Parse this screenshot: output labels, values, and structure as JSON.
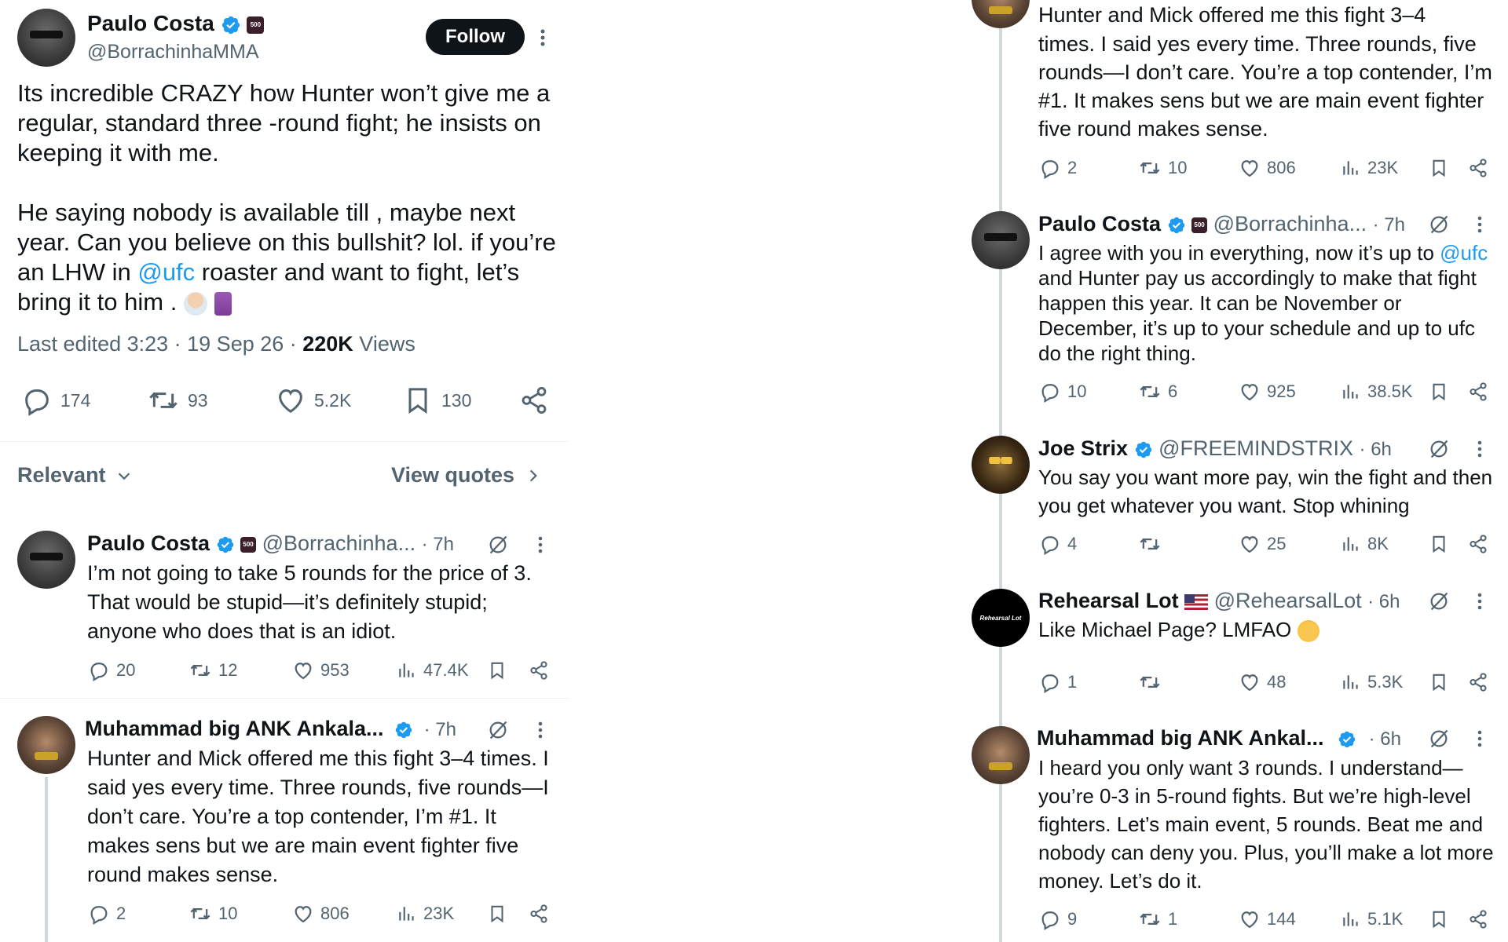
{
  "main_tweet": {
    "author_name": "Paulo Costa",
    "author_handle": "@BorrachinhaMMA",
    "affiliate_badge": "500",
    "follow_label": "Follow",
    "text_para1": "Its incredible CRAZY how Hunter won’t give me a regular, standard three -round fight; he insists on keeping it with me.",
    "text_para2_pre": "He saying nobody is available till , maybe next year. Can you believe on this bullshit? lol. if you’re an LHW in ",
    "text_link": "@ufc",
    "text_para2_post": " roaster and want to fight, let’s bring it to him .",
    "meta_prefix": "Last edited 3:23 · 19 Sep 26 · ",
    "views_count": "220K",
    "views_label": " Views",
    "stats": {
      "replies": "174",
      "reposts": "93",
      "likes": "5.2K",
      "bookmarks": "130"
    }
  },
  "sort_bar": {
    "sort_label": "Relevant",
    "quotes_label": "View quotes"
  },
  "left_replies": [
    {
      "name": "Paulo Costa",
      "handle": "@Borrachinha...",
      "time": "· 7h",
      "text": "I’m not going to take 5 rounds for the price of 3. That would be stupid—it’s definitely stupid; anyone who does that is an idiot.",
      "replies": "20",
      "reposts": "12",
      "likes": "953",
      "views": "47.4K"
    },
    {
      "name": "Muhammad big ANK Ankala...",
      "handle": "",
      "time": "· 7h",
      "text": "Hunter and Mick offered me this fight 3–4 times. I said yes every time. Three rounds, five rounds—I don’t care. You’re a top contender, I’m #1. It makes sens but we are main event fighter five round makes sense.",
      "replies": "2",
      "reposts": "10",
      "likes": "806",
      "views": "23K"
    }
  ],
  "right_top": {
    "text_partial_line": "Hunter and Mick offered me this fight 3–4",
    "text_rest": "times. I said yes every time. Three rounds, five rounds—I don’t care. You’re a top contender, I’m #1. It makes sens but we are main event fighter five round makes sense.",
    "replies": "2",
    "reposts": "10",
    "likes": "806",
    "views": "23K"
  },
  "right_replies": [
    {
      "name": "Paulo Costa",
      "handle": "@Borrachinha...",
      "time": "· 7h",
      "text_pre": "I agree with you in everything, now it’s up to ",
      "text_link": "@ufc",
      "text_post": " and Hunter pay us accordingly to make that fight happen this year. It can be November or December, it’s up to your schedule and up to ufc do the right thing.",
      "replies": "10",
      "reposts": "6",
      "likes": "925",
      "views": "38.5K"
    },
    {
      "name": "Joe Strix",
      "handle": "@FREEMINDSTRIX",
      "time": "· 6h",
      "text": "You say you want more pay, win the fight and then you get whatever you want. Stop whining",
      "replies": "4",
      "reposts": "",
      "likes": "25",
      "views": "8K"
    },
    {
      "name": "Rehearsal Lot",
      "handle": "@RehearsalLot",
      "time": "· 6h",
      "avatar_text": "Rehearsal Lot",
      "text": "Like Michael Page? LMFAO",
      "replies": "1",
      "reposts": "",
      "likes": "48",
      "views": "5.3K"
    },
    {
      "name": "Muhammad big ANK Ankal...",
      "handle": "",
      "time": "· 6h",
      "text": "I heard you only want 3 rounds. I understand—you’re 0-3 in 5-round fights. But we’re high-level fighters. Let’s main event, 5 rounds. Beat me and nobody can deny you. Plus, you’ll make a lot more money. Let’s do it.",
      "replies": "9",
      "reposts": "1",
      "likes": "144",
      "views": "5.1K"
    }
  ],
  "colors": {
    "link": "#1d9bf0",
    "verified": "#1d9bf0",
    "text": "#0f1419",
    "muted": "#536471"
  }
}
